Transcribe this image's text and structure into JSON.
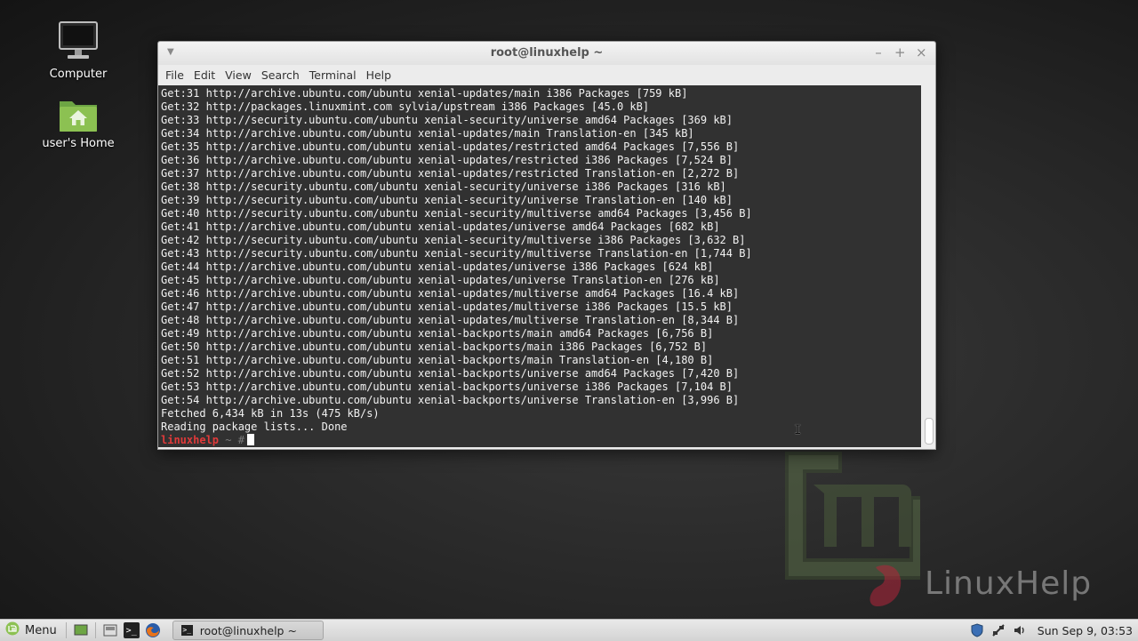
{
  "desktop": {
    "icons": [
      {
        "label": "Computer"
      },
      {
        "label": "user's Home"
      }
    ],
    "watermark": "LinuxHelp"
  },
  "window": {
    "title": "root@linuxhelp ~",
    "menus": [
      "File",
      "Edit",
      "View",
      "Search",
      "Terminal",
      "Help"
    ]
  },
  "terminal": {
    "lines": [
      "Get:31 http://archive.ubuntu.com/ubuntu xenial-updates/main i386 Packages [759 kB]",
      "Get:32 http://packages.linuxmint.com sylvia/upstream i386 Packages [45.0 kB]",
      "Get:33 http://security.ubuntu.com/ubuntu xenial-security/universe amd64 Packages [369 kB]",
      "Get:34 http://archive.ubuntu.com/ubuntu xenial-updates/main Translation-en [345 kB]",
      "Get:35 http://archive.ubuntu.com/ubuntu xenial-updates/restricted amd64 Packages [7,556 B]",
      "Get:36 http://archive.ubuntu.com/ubuntu xenial-updates/restricted i386 Packages [7,524 B]",
      "Get:37 http://archive.ubuntu.com/ubuntu xenial-updates/restricted Translation-en [2,272 B]",
      "Get:38 http://security.ubuntu.com/ubuntu xenial-security/universe i386 Packages [316 kB]",
      "Get:39 http://security.ubuntu.com/ubuntu xenial-security/universe Translation-en [140 kB]",
      "Get:40 http://security.ubuntu.com/ubuntu xenial-security/multiverse amd64 Packages [3,456 B]",
      "Get:41 http://archive.ubuntu.com/ubuntu xenial-updates/universe amd64 Packages [682 kB]",
      "Get:42 http://security.ubuntu.com/ubuntu xenial-security/multiverse i386 Packages [3,632 B]",
      "Get:43 http://security.ubuntu.com/ubuntu xenial-security/multiverse Translation-en [1,744 B]",
      "Get:44 http://archive.ubuntu.com/ubuntu xenial-updates/universe i386 Packages [624 kB]",
      "Get:45 http://archive.ubuntu.com/ubuntu xenial-updates/universe Translation-en [276 kB]",
      "Get:46 http://archive.ubuntu.com/ubuntu xenial-updates/multiverse amd64 Packages [16.4 kB]",
      "Get:47 http://archive.ubuntu.com/ubuntu xenial-updates/multiverse i386 Packages [15.5 kB]",
      "Get:48 http://archive.ubuntu.com/ubuntu xenial-updates/multiverse Translation-en [8,344 B]",
      "Get:49 http://archive.ubuntu.com/ubuntu xenial-backports/main amd64 Packages [6,756 B]",
      "Get:50 http://archive.ubuntu.com/ubuntu xenial-backports/main i386 Packages [6,752 B]",
      "Get:51 http://archive.ubuntu.com/ubuntu xenial-backports/main Translation-en [4,180 B]",
      "Get:52 http://archive.ubuntu.com/ubuntu xenial-backports/universe amd64 Packages [7,420 B]",
      "Get:53 http://archive.ubuntu.com/ubuntu xenial-backports/universe i386 Packages [7,104 B]",
      "Get:54 http://archive.ubuntu.com/ubuntu xenial-backports/universe Translation-en [3,996 B]",
      "Fetched 6,434 kB in 13s (475 kB/s)",
      "Reading package lists... Done"
    ],
    "prompt_user": "linuxhelp",
    "prompt_rest": " ~ #"
  },
  "taskbar": {
    "menu_label": "Menu",
    "task_label": "root@linuxhelp ~",
    "clock": "Sun Sep  9, 03:53"
  },
  "colors": {
    "terminal_bg": "#313131",
    "prompt_user": "#e03a3a",
    "mint_green": "#8cc152"
  }
}
